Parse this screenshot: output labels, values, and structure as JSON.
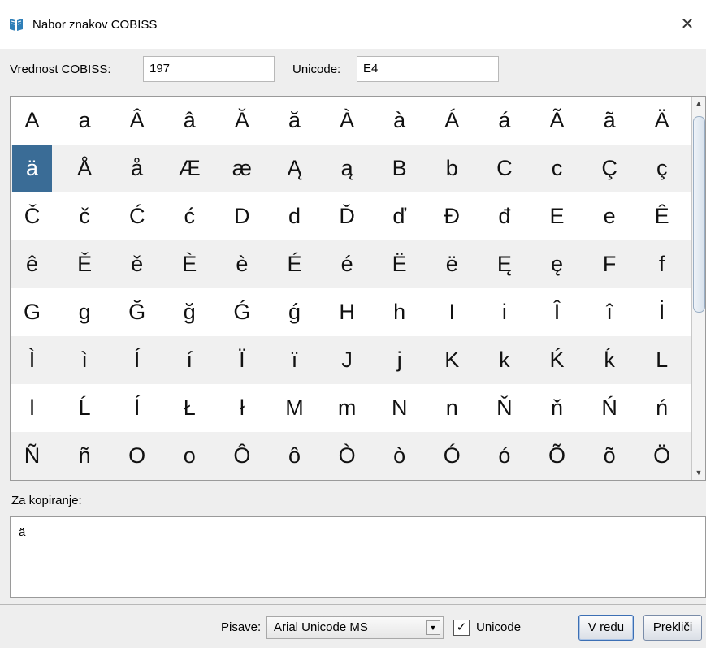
{
  "window": {
    "title": "Nabor znakov COBISS",
    "close_glyph": "✕",
    "icon": "book-icon",
    "accent_color": "#3a6c96"
  },
  "fields": {
    "cobiss_label": "Vrednost COBISS:",
    "cobiss_value": "197",
    "unicode_label": "Unicode:",
    "unicode_value": "E4"
  },
  "grid": {
    "rows": [
      [
        "A",
        "a",
        "Â",
        "â",
        "Ă",
        "ă",
        "À",
        "à",
        "Á",
        "á",
        "Ã",
        "ã",
        "Ä"
      ],
      [
        "ä",
        "Å",
        "å",
        "Æ",
        "æ",
        "Ą",
        "ą",
        "B",
        "b",
        "C",
        "c",
        "Ç",
        "ç"
      ],
      [
        "Č",
        "č",
        "Ć",
        "ć",
        "D",
        "d",
        "Ď",
        "ď",
        "Đ",
        "đ",
        "E",
        "e",
        "Ê"
      ],
      [
        "ê",
        "Ě",
        "ě",
        "È",
        "è",
        "É",
        "é",
        "Ë",
        "ë",
        "Ę",
        "ę",
        "F",
        "f"
      ],
      [
        "G",
        "g",
        "Ğ",
        "ğ",
        "Ǵ",
        "ǵ",
        "H",
        "h",
        "I",
        "i",
        "Î",
        "î",
        "İ"
      ],
      [
        "Ì",
        "ì",
        "Í",
        "í",
        "Ï",
        "ï",
        "J",
        "j",
        "K",
        "k",
        "Ḱ",
        "ḱ",
        "L"
      ],
      [
        "l",
        "Ĺ",
        "ĺ",
        "Ł",
        "ł",
        "M",
        "m",
        "N",
        "n",
        "Ň",
        "ň",
        "Ń",
        "ń"
      ],
      [
        "Ñ",
        "ñ",
        "O",
        "o",
        "Ô",
        "ô",
        "Ò",
        "ò",
        "Ó",
        "ó",
        "Õ",
        "õ",
        "Ö"
      ]
    ],
    "selected": {
      "row": 1,
      "col": 0
    },
    "scroll_up": "▲",
    "scroll_down": "▼"
  },
  "copy": {
    "label": "Za kopiranje:",
    "value": "ä"
  },
  "footer": {
    "font_label": "Pisave:",
    "font_value": "Arial Unicode MS",
    "dropdown_glyph": "▼",
    "unicode_checkbox_label": "Unicode",
    "unicode_checked": true,
    "checkmark": "✓",
    "ok_label": "V redu",
    "cancel_label": "Prekliči"
  }
}
